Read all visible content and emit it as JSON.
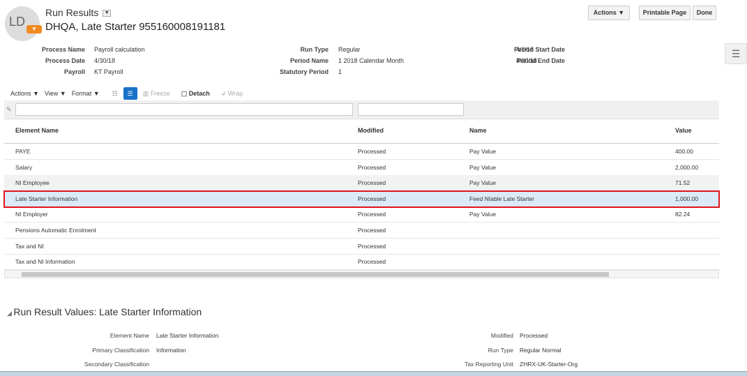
{
  "header": {
    "avatar_initials": "LD",
    "title": "Run Results",
    "person": "DHQA, Late Starter 955160008191181"
  },
  "buttons": {
    "actions": "Actions ▼",
    "printable": "Printable Page",
    "done": "Done"
  },
  "info": [
    {
      "label": "Process Name",
      "value": "Payroll calculation"
    },
    {
      "label": "Process Date",
      "value": "4/30/18"
    },
    {
      "label": "Payroll",
      "value": "KT Payroll"
    },
    {
      "label": "Run Type",
      "value": "Regular"
    },
    {
      "label": "Period Name",
      "value": "1 2018 Calendar Month"
    },
    {
      "label": "Statutory Period",
      "value": "1"
    },
    {
      "label": "Period Start Date",
      "value": "4/1/18"
    },
    {
      "label": "Period End Date",
      "value": "4/30/18"
    }
  ],
  "toolbar": {
    "actions": "Actions ▼",
    "view": "View ▼",
    "format": "Format ▼",
    "freeze": "Freeze",
    "detach": "Detach",
    "wrap": "Wrap"
  },
  "table": {
    "columns": [
      "Element Name",
      "Modified",
      "Name",
      "Value"
    ],
    "rows": [
      [
        "PAYE",
        "Processed",
        "Pay Value",
        "400.00"
      ],
      [
        "Salary",
        "Processed",
        "Pay Value",
        "2,000.00"
      ],
      [
        "NI Employee",
        "Processed",
        "Pay Value",
        "71.52"
      ],
      [
        "Late Starter Information",
        "Processed",
        "Feed NIable Late Starter",
        "1,000.00"
      ],
      [
        "NI Employer",
        "Processed",
        "Pay Value",
        "82.24"
      ],
      [
        "Pensions Automatic Enrolment",
        "Processed",
        "",
        ""
      ],
      [
        "Tax and NI",
        "Processed",
        "",
        ""
      ],
      [
        "Tax and NI Information",
        "Processed",
        "",
        ""
      ]
    ]
  },
  "detail": {
    "title": "Run Result Values: Late Starter Information",
    "fields": [
      {
        "label": "Element Name",
        "value": "Late Starter Information"
      },
      {
        "label": "Primary Classification",
        "value": "Information"
      },
      {
        "label": "Secondary Classification",
        "value": ""
      },
      {
        "label": "Modified",
        "value": "Processed"
      },
      {
        "label": "Run Type",
        "value": "Regular Normal"
      },
      {
        "label": "Tax Reporting Unit",
        "value": "ZHRX-UK-Starter-Org"
      }
    ]
  }
}
